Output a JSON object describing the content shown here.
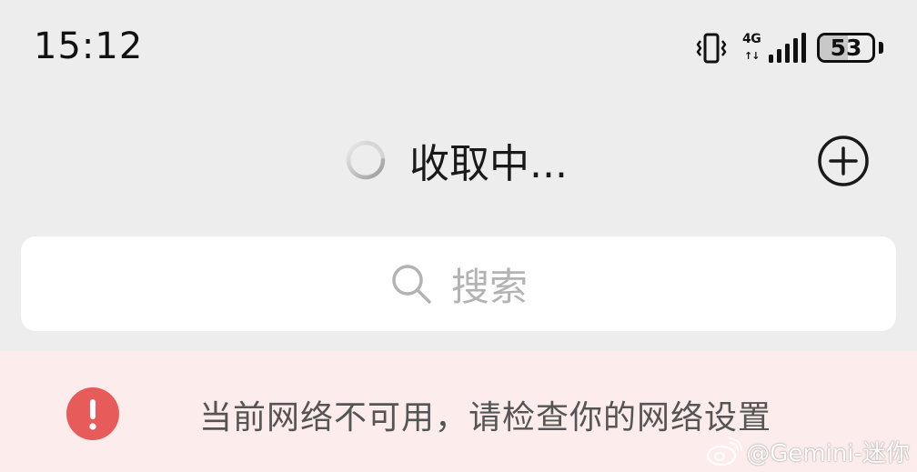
{
  "status_bar": {
    "time": "15:12",
    "network_type": "4G",
    "network_arrows": "↑↓",
    "battery_level": "53",
    "battery_fraction": 0.53,
    "icons": [
      "vibrate-icon",
      "signal-icon",
      "battery-icon"
    ]
  },
  "header": {
    "title": "收取中...",
    "spinner_icon": "loading-spinner-icon",
    "add_icon": "plus-circle-icon"
  },
  "search": {
    "placeholder": "搜索",
    "icon": "search-icon"
  },
  "error_banner": {
    "message": "当前网络不可用，请检查你的网络设置",
    "icon": "exclamation-circle-icon",
    "icon_color": "#e75b5b",
    "background": "#fdecec"
  },
  "watermark": {
    "text": "@Gemini-迷你",
    "logo": "weibo-logo"
  },
  "colors": {
    "page_background": "#ededed",
    "search_background": "#ffffff",
    "text_primary": "#191919",
    "text_placeholder": "#b3b3b3",
    "text_error": "#555555"
  }
}
